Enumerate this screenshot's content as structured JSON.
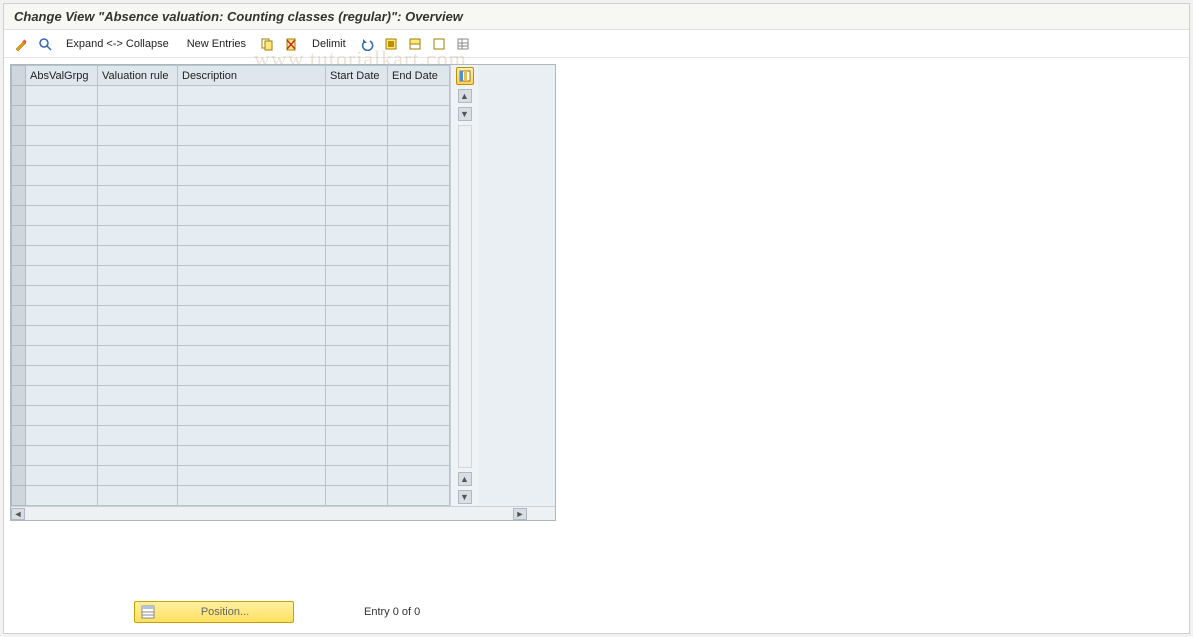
{
  "title": "Change View \"Absence valuation: Counting classes (regular)\": Overview",
  "toolbar": {
    "expand_collapse": "Expand <-> Collapse",
    "new_entries": "New Entries",
    "delimit": "Delimit",
    "icons": {
      "toggle": "toggle-display-change-icon",
      "find": "find-icon",
      "copy": "copy-icon",
      "delete": "delete-icon",
      "undo": "undo-icon",
      "select_all": "select-all-icon",
      "select_block": "select-block-icon",
      "deselect_all": "deselect-all-icon",
      "table_settings": "table-settings-icon"
    }
  },
  "table": {
    "columns": [
      "AbsValGrpg",
      "Valuation rule",
      "Description",
      "Start Date",
      "End Date"
    ],
    "row_count": 21,
    "rows": []
  },
  "footer": {
    "position_label": "Position...",
    "entry_status": "Entry 0 of 0"
  },
  "watermark": "www.tutorialkart.com"
}
